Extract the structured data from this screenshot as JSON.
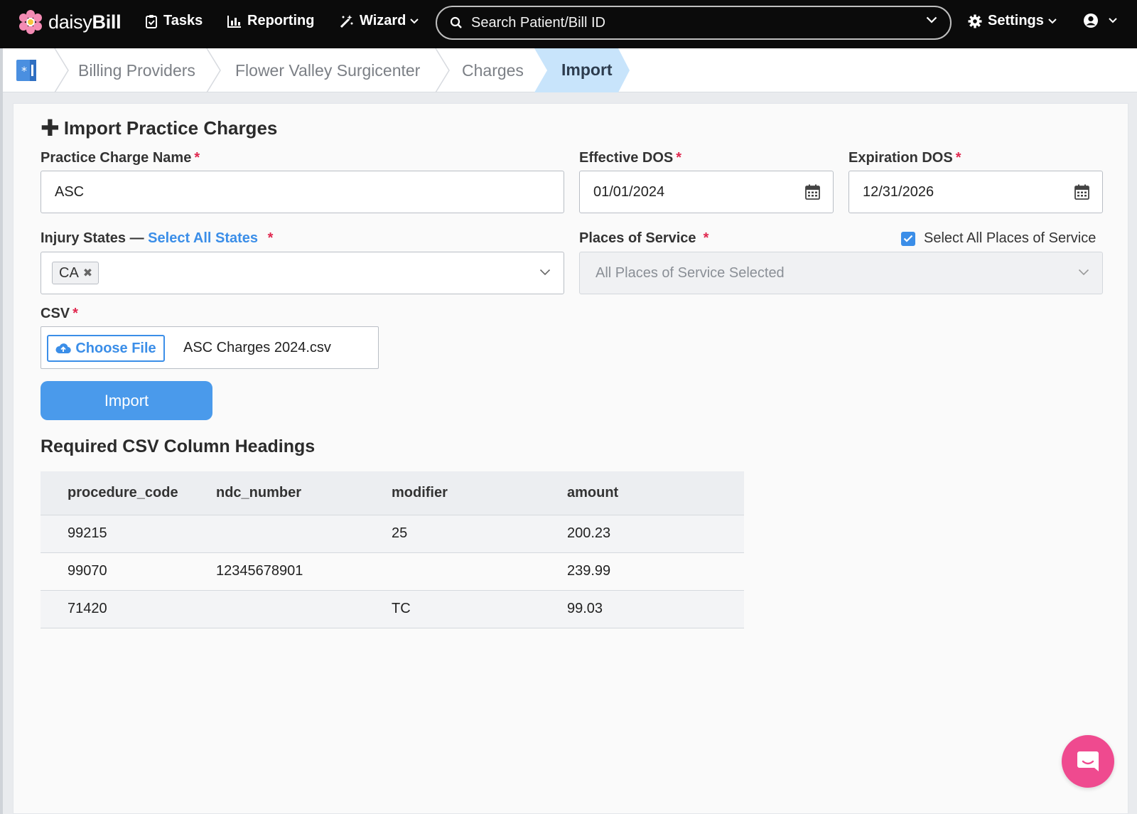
{
  "nav": {
    "brand_light": "daisy",
    "brand_bold": "Bill",
    "tasks": "Tasks",
    "reporting": "Reporting",
    "wizard": "Wizard",
    "search_placeholder": "Search Patient/Bill ID",
    "settings": "Settings"
  },
  "breadcrumb": {
    "items": [
      "Billing Providers",
      "Flower Valley Surgicenter",
      "Charges"
    ],
    "active": "Import"
  },
  "form": {
    "title": "Import Practice Charges",
    "charge_name_label": "Practice Charge Name",
    "charge_name_value": "ASC",
    "effective_label": "Effective DOS",
    "effective_value": "01/01/2024",
    "expiration_label": "Expiration DOS",
    "expiration_value": "12/31/2026",
    "injury_label": "Injury States —",
    "injury_link": "Select All States",
    "injury_tags": [
      "CA"
    ],
    "pos_label": "Places of Service",
    "pos_checkbox_label": "Select All Places of Service",
    "pos_checked": true,
    "pos_value": "All Places of Service Selected",
    "csv_label": "CSV",
    "choose_file": "Choose File",
    "file_name": "ASC Charges 2024.csv",
    "required_mark": "*",
    "import_button": "Import"
  },
  "headings": {
    "title": "Required CSV Column Headings",
    "columns": [
      "procedure_code",
      "ndc_number",
      "modifier",
      "amount"
    ],
    "rows": [
      [
        "99215",
        "",
        "25",
        "200.23"
      ],
      [
        "99070",
        "12345678901",
        "",
        "239.99"
      ],
      [
        "71420",
        "",
        "TC",
        "99.03"
      ]
    ]
  },
  "colors": {
    "accent": "#3b8ee8",
    "button": "#4a9aeb",
    "required": "#e0284f",
    "annotation_arrow": "#f0336f",
    "chat": "#ef4a8f",
    "nav_bg": "#0b0b0b"
  },
  "icons": [
    "daisy-logo-icon",
    "clipboard-icon",
    "bar-chart-icon",
    "wand-icon",
    "search-icon",
    "gear-icon",
    "user-icon",
    "calendar-icon",
    "cloud-upload-icon",
    "chat-icon"
  ]
}
